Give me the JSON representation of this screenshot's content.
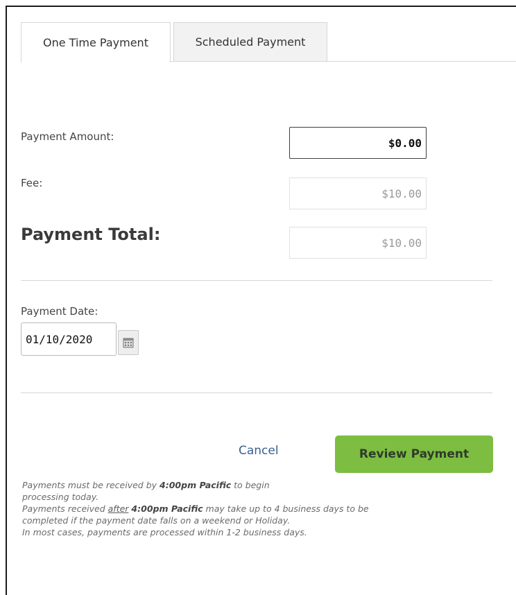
{
  "tabs": [
    {
      "label": "One Time Payment",
      "active": true
    },
    {
      "label": "Scheduled Payment",
      "active": false
    }
  ],
  "form": {
    "amount_label": "Payment Amount:",
    "amount_value": "$0.00",
    "fee_label": "Fee:",
    "fee_value": "$10.00",
    "total_label": "Payment Total:",
    "total_value": "$10.00",
    "date_label": "Payment Date:",
    "date_value": "01/10/2020"
  },
  "actions": {
    "cancel_label": "Cancel",
    "review_label": "Review Payment"
  },
  "notes": {
    "line1_pre": "Payments must be received by ",
    "line1_bold": "4:00pm Pacific",
    "line1_post": " to begin",
    "line2": "processing today.",
    "line3_pre": "Payments received ",
    "line3_underline": "after",
    "line3_bold": "4:00pm Pacific",
    "line3_post": " may take up to 4 business days to be",
    "line4": "completed if the payment date falls on a weekend or Holiday.",
    "line5": "In most cases, payments are processed within 1-2 business days."
  },
  "colors": {
    "accent_green": "#7dbd41",
    "link_blue": "#3a5f8f"
  },
  "icons": {
    "calendar": "calendar-icon"
  }
}
